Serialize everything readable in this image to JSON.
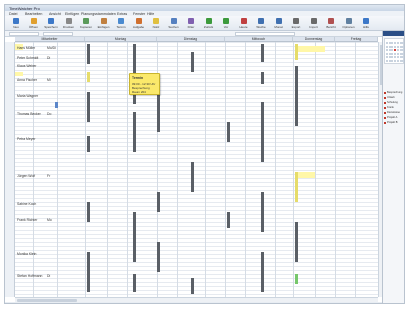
{
  "window": {
    "title": "TimeWatcher Pro"
  },
  "menu": [
    "Datei",
    "Bearbeiten",
    "Ansicht",
    "Einfügen",
    "Planungsstammdaten",
    "Extras",
    "Fenster",
    "Hilfe"
  ],
  "toolbar": [
    {
      "label": "Neu",
      "icon": "new-icon",
      "color": "#3c78c8"
    },
    {
      "label": "Öffnen",
      "icon": "open-icon",
      "color": "#e0a030"
    },
    {
      "label": "Speichern",
      "icon": "save-icon",
      "color": "#3c78c8"
    },
    {
      "label": "Drucken",
      "icon": "print-icon",
      "color": "#888888"
    },
    {
      "label": "Kopieren",
      "icon": "copy-icon",
      "color": "#5a9a5a"
    },
    {
      "label": "Einfügen",
      "icon": "paste-icon",
      "color": "#c08040"
    },
    {
      "label": "Termin",
      "icon": "appointment-icon",
      "color": "#4a8ad0"
    },
    {
      "label": "Aufgabe",
      "icon": "task-icon",
      "color": "#d07030"
    },
    {
      "label": "Notiz",
      "icon": "note-icon",
      "color": "#e0c040"
    },
    {
      "label": "Suchen",
      "icon": "search-icon",
      "color": "#5580c0"
    },
    {
      "label": "Filter",
      "icon": "filter-icon",
      "color": "#8060b0"
    },
    {
      "label": "Zurück",
      "icon": "back-icon",
      "color": "#3c9a3c"
    },
    {
      "label": "Vor",
      "icon": "forward-icon",
      "color": "#3c9a3c"
    },
    {
      "label": "Heute",
      "icon": "today-icon",
      "color": "#c04040"
    },
    {
      "label": "Woche",
      "icon": "week-icon",
      "color": "#4070b0"
    },
    {
      "label": "Monat",
      "icon": "month-icon",
      "color": "#4070b0"
    },
    {
      "label": "Export",
      "icon": "export-icon",
      "color": "#6a6a6a"
    },
    {
      "label": "Import",
      "icon": "import-icon",
      "color": "#6a6a6a"
    },
    {
      "label": "Bericht",
      "icon": "report-icon",
      "color": "#b05050"
    },
    {
      "label": "Optionen",
      "icon": "options-icon",
      "color": "#6080a0"
    },
    {
      "label": "Hilfe",
      "icon": "help-icon",
      "color": "#3c78c8"
    }
  ],
  "columns": [
    "Mitarbeiter",
    "Montag",
    "Dienstag",
    "Mittwoch",
    "Donnerstag",
    "Freitag"
  ],
  "rows": [
    {
      "name": "Hans Müller",
      "code": "Mo/Di"
    },
    {
      "name": "Peter Schmidt",
      "code": "Di"
    },
    {
      "name": "Klaus Weber",
      "code": ""
    },
    {
      "name": "Anna Fischer",
      "code": "Mi"
    },
    {
      "name": "Maria Wagner",
      "code": ""
    },
    {
      "name": "Thomas Becker",
      "code": "Do"
    },
    {
      "name": "Petra Meyer",
      "code": ""
    },
    {
      "name": "Jürgen Wolf",
      "code": "Fr"
    },
    {
      "name": "Sabine Koch",
      "code": ""
    },
    {
      "name": "Frank Richter",
      "code": "Mo"
    },
    {
      "name": "Monika Klein",
      "code": ""
    },
    {
      "name": "Stefan Hoffmann",
      "code": "Di"
    }
  ],
  "tooltip": {
    "title": "Termin",
    "lines": [
      "09:00 - 12:30 Uhr",
      "Besprechung",
      "Raum 204"
    ]
  },
  "sidebar": {
    "items": [
      "Besprechung",
      "Urlaub",
      "Schulung",
      "Krank",
      "Dienstreise",
      "Projekt A",
      "Projekt B"
    ]
  }
}
